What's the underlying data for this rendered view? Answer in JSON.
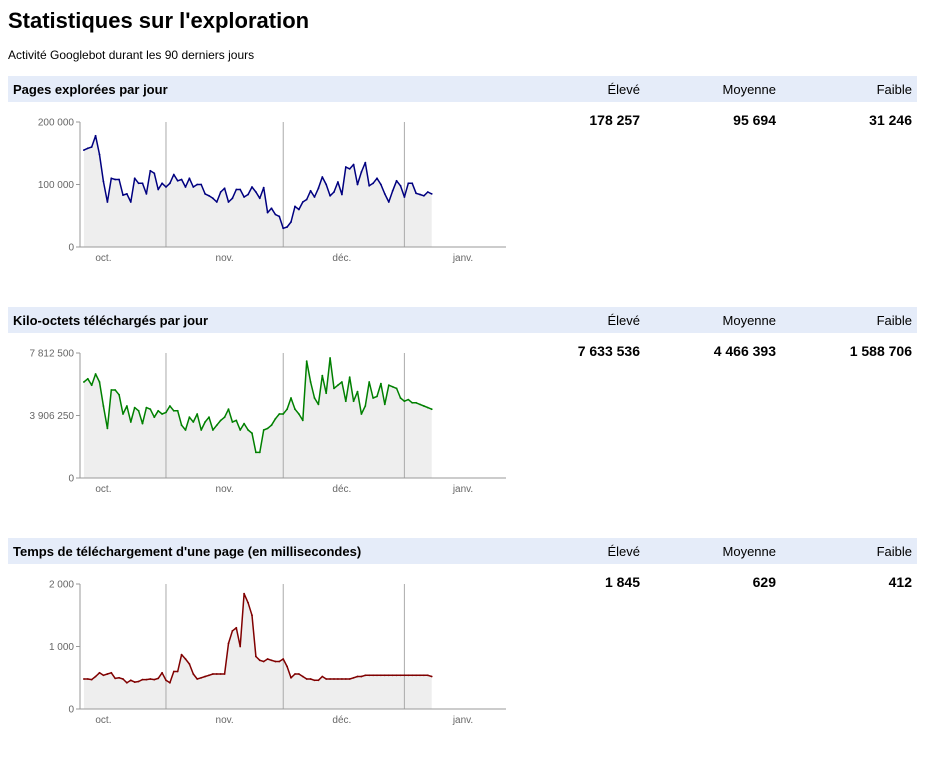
{
  "page": {
    "title": "Statistiques sur l'exploration",
    "subtitle": "Activité Googlebot durant les 90 derniers jours"
  },
  "columns": {
    "high": "Élevé",
    "avg": "Moyenne",
    "low": "Faible"
  },
  "sections": [
    {
      "title": "Pages explorées par jour",
      "high": "178 257",
      "avg": "95 694",
      "low": "31 246"
    },
    {
      "title": "Kilo-octets téléchargés par jour",
      "high": "7 633 536",
      "avg": "4 466 393",
      "low": "1 588 706"
    },
    {
      "title": "Temps de téléchargement d'une page (en millisecondes)",
      "high": "1 845",
      "avg": "629",
      "low": "412"
    }
  ],
  "chart_data": [
    {
      "type": "area",
      "color": "#000080",
      "fill": "#eeeeee",
      "ylim": [
        0,
        200000
      ],
      "yticks": [
        {
          "value": 200000,
          "label": "200 000"
        },
        {
          "value": 100000,
          "label": "100 000"
        },
        {
          "value": 0,
          "label": "0"
        }
      ],
      "xlim": [
        0,
        109
      ],
      "xtick_labels": [
        {
          "x": 6,
          "label": "oct."
        },
        {
          "x": 37,
          "label": "nov."
        },
        {
          "x": 67,
          "label": "déc."
        },
        {
          "x": 98,
          "label": "janv."
        }
      ],
      "gridlines_x": [
        22,
        52,
        83
      ],
      "x_start": 1,
      "values": [
        155000,
        158000,
        160000,
        178000,
        148000,
        105000,
        72000,
        110000,
        108000,
        108000,
        83000,
        85000,
        72000,
        110000,
        102000,
        102000,
        85000,
        122000,
        118000,
        92000,
        102000,
        96000,
        102000,
        116000,
        106000,
        108000,
        96000,
        110000,
        96000,
        100000,
        100000,
        85000,
        82000,
        78000,
        72000,
        88000,
        94000,
        72000,
        78000,
        92000,
        92000,
        80000,
        84000,
        96000,
        88000,
        78000,
        95000,
        55000,
        62000,
        52000,
        49000,
        30000,
        32000,
        40000,
        65000,
        60000,
        72000,
        76000,
        90000,
        80000,
        94000,
        112000,
        100000,
        82000,
        88000,
        104000,
        84000,
        128000,
        125000,
        132000,
        100000,
        120000,
        135000,
        98000,
        102000,
        110000,
        100000,
        85000,
        72000,
        90000,
        106000,
        98000,
        80000,
        102000,
        102000,
        86000,
        84000,
        82000,
        88000,
        85000
      ]
    },
    {
      "type": "area",
      "color": "#008000",
      "fill": "#eeeeee",
      "ylim": [
        0,
        7812500
      ],
      "yticks": [
        {
          "value": 7812500,
          "label": "7 812 500"
        },
        {
          "value": 3906250,
          "label": "3 906 250"
        },
        {
          "value": 0,
          "label": "0"
        }
      ],
      "xlim": [
        0,
        109
      ],
      "xtick_labels": [
        {
          "x": 6,
          "label": "oct."
        },
        {
          "x": 37,
          "label": "nov."
        },
        {
          "x": 67,
          "label": "déc."
        },
        {
          "x": 98,
          "label": "janv."
        }
      ],
      "gridlines_x": [
        22,
        52,
        83
      ],
      "x_start": 1,
      "values": [
        6000000,
        6200000,
        5800000,
        6500000,
        6000000,
        4500000,
        3100000,
        5500000,
        5500000,
        5200000,
        4000000,
        4500000,
        3500000,
        4400000,
        4200000,
        3400000,
        4400000,
        4300000,
        3800000,
        4200000,
        4000000,
        4100000,
        4500000,
        4200000,
        4200000,
        3300000,
        3000000,
        3800000,
        3500000,
        4000000,
        3000000,
        3500000,
        3800000,
        3000000,
        3300000,
        3600000,
        3800000,
        4300000,
        3500000,
        3600000,
        3000000,
        3400000,
        3000000,
        2800000,
        1600000,
        1600000,
        3000000,
        3100000,
        3300000,
        3700000,
        4000000,
        4000000,
        4300000,
        5000000,
        4300000,
        4000000,
        3600000,
        7300000,
        6000000,
        5000000,
        4600000,
        6400000,
        5300000,
        7500000,
        5600000,
        5800000,
        6000000,
        4800000,
        6300000,
        4800000,
        5400000,
        4000000,
        4500000,
        6000000,
        5000000,
        5100000,
        5900000,
        4600000,
        5800000,
        5700000,
        5600000,
        5000000,
        4800000,
        4900000,
        4700000,
        4700000,
        4600000,
        4500000,
        4400000,
        4300000
      ]
    },
    {
      "type": "area",
      "color": "#800000",
      "fill": "#eeeeee",
      "ylim": [
        0,
        2000
      ],
      "yticks": [
        {
          "value": 2000,
          "label": "2 000"
        },
        {
          "value": 1000,
          "label": "1 000"
        },
        {
          "value": 0,
          "label": "0"
        }
      ],
      "xlim": [
        0,
        109
      ],
      "xtick_labels": [
        {
          "x": 6,
          "label": "oct."
        },
        {
          "x": 37,
          "label": "nov."
        },
        {
          "x": 67,
          "label": "déc."
        },
        {
          "x": 98,
          "label": "janv."
        }
      ],
      "gridlines_x": [
        22,
        52,
        83
      ],
      "x_start": 1,
      "values": [
        480,
        480,
        470,
        520,
        580,
        540,
        560,
        580,
        490,
        500,
        480,
        420,
        460,
        430,
        440,
        470,
        470,
        480,
        470,
        490,
        580,
        460,
        420,
        600,
        600,
        870,
        800,
        720,
        560,
        480,
        500,
        520,
        540,
        560,
        560,
        560,
        560,
        1050,
        1250,
        1300,
        1000,
        1845,
        1700,
        1500,
        840,
        780,
        760,
        800,
        780,
        760,
        760,
        800,
        680,
        500,
        560,
        560,
        520,
        480,
        480,
        460,
        460,
        520,
        480,
        480,
        480,
        480,
        480,
        480,
        480,
        500,
        520,
        520,
        540,
        540,
        540,
        540,
        540,
        540,
        540,
        540,
        540,
        540,
        540,
        540,
        540,
        540,
        540,
        540,
        540,
        520
      ]
    }
  ]
}
